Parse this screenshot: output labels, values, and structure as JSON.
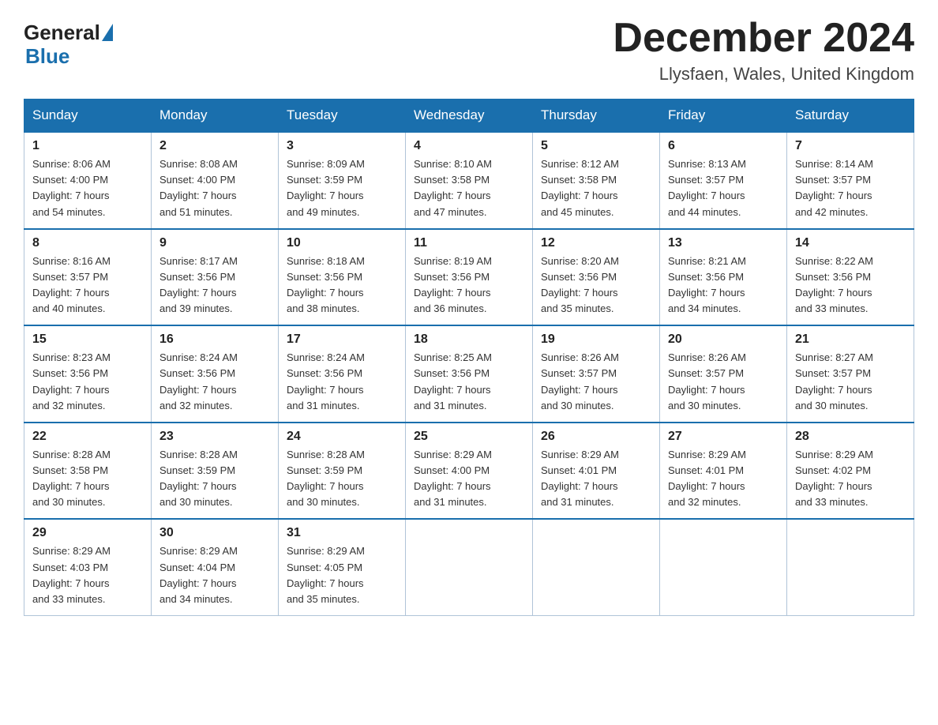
{
  "header": {
    "logo_general": "General",
    "logo_blue": "Blue",
    "month_year": "December 2024",
    "location": "Llysfaen, Wales, United Kingdom"
  },
  "weekdays": [
    "Sunday",
    "Monday",
    "Tuesday",
    "Wednesday",
    "Thursday",
    "Friday",
    "Saturday"
  ],
  "weeks": [
    [
      {
        "day": "1",
        "sunrise": "8:06 AM",
        "sunset": "4:00 PM",
        "daylight": "7 hours and 54 minutes."
      },
      {
        "day": "2",
        "sunrise": "8:08 AM",
        "sunset": "4:00 PM",
        "daylight": "7 hours and 51 minutes."
      },
      {
        "day": "3",
        "sunrise": "8:09 AM",
        "sunset": "3:59 PM",
        "daylight": "7 hours and 49 minutes."
      },
      {
        "day": "4",
        "sunrise": "8:10 AM",
        "sunset": "3:58 PM",
        "daylight": "7 hours and 47 minutes."
      },
      {
        "day": "5",
        "sunrise": "8:12 AM",
        "sunset": "3:58 PM",
        "daylight": "7 hours and 45 minutes."
      },
      {
        "day": "6",
        "sunrise": "8:13 AM",
        "sunset": "3:57 PM",
        "daylight": "7 hours and 44 minutes."
      },
      {
        "day": "7",
        "sunrise": "8:14 AM",
        "sunset": "3:57 PM",
        "daylight": "7 hours and 42 minutes."
      }
    ],
    [
      {
        "day": "8",
        "sunrise": "8:16 AM",
        "sunset": "3:57 PM",
        "daylight": "7 hours and 40 minutes."
      },
      {
        "day": "9",
        "sunrise": "8:17 AM",
        "sunset": "3:56 PM",
        "daylight": "7 hours and 39 minutes."
      },
      {
        "day": "10",
        "sunrise": "8:18 AM",
        "sunset": "3:56 PM",
        "daylight": "7 hours and 38 minutes."
      },
      {
        "day": "11",
        "sunrise": "8:19 AM",
        "sunset": "3:56 PM",
        "daylight": "7 hours and 36 minutes."
      },
      {
        "day": "12",
        "sunrise": "8:20 AM",
        "sunset": "3:56 PM",
        "daylight": "7 hours and 35 minutes."
      },
      {
        "day": "13",
        "sunrise": "8:21 AM",
        "sunset": "3:56 PM",
        "daylight": "7 hours and 34 minutes."
      },
      {
        "day": "14",
        "sunrise": "8:22 AM",
        "sunset": "3:56 PM",
        "daylight": "7 hours and 33 minutes."
      }
    ],
    [
      {
        "day": "15",
        "sunrise": "8:23 AM",
        "sunset": "3:56 PM",
        "daylight": "7 hours and 32 minutes."
      },
      {
        "day": "16",
        "sunrise": "8:24 AM",
        "sunset": "3:56 PM",
        "daylight": "7 hours and 32 minutes."
      },
      {
        "day": "17",
        "sunrise": "8:24 AM",
        "sunset": "3:56 PM",
        "daylight": "7 hours and 31 minutes."
      },
      {
        "day": "18",
        "sunrise": "8:25 AM",
        "sunset": "3:56 PM",
        "daylight": "7 hours and 31 minutes."
      },
      {
        "day": "19",
        "sunrise": "8:26 AM",
        "sunset": "3:57 PM",
        "daylight": "7 hours and 30 minutes."
      },
      {
        "day": "20",
        "sunrise": "8:26 AM",
        "sunset": "3:57 PM",
        "daylight": "7 hours and 30 minutes."
      },
      {
        "day": "21",
        "sunrise": "8:27 AM",
        "sunset": "3:57 PM",
        "daylight": "7 hours and 30 minutes."
      }
    ],
    [
      {
        "day": "22",
        "sunrise": "8:28 AM",
        "sunset": "3:58 PM",
        "daylight": "7 hours and 30 minutes."
      },
      {
        "day": "23",
        "sunrise": "8:28 AM",
        "sunset": "3:59 PM",
        "daylight": "7 hours and 30 minutes."
      },
      {
        "day": "24",
        "sunrise": "8:28 AM",
        "sunset": "3:59 PM",
        "daylight": "7 hours and 30 minutes."
      },
      {
        "day": "25",
        "sunrise": "8:29 AM",
        "sunset": "4:00 PM",
        "daylight": "7 hours and 31 minutes."
      },
      {
        "day": "26",
        "sunrise": "8:29 AM",
        "sunset": "4:01 PM",
        "daylight": "7 hours and 31 minutes."
      },
      {
        "day": "27",
        "sunrise": "8:29 AM",
        "sunset": "4:01 PM",
        "daylight": "7 hours and 32 minutes."
      },
      {
        "day": "28",
        "sunrise": "8:29 AM",
        "sunset": "4:02 PM",
        "daylight": "7 hours and 33 minutes."
      }
    ],
    [
      {
        "day": "29",
        "sunrise": "8:29 AM",
        "sunset": "4:03 PM",
        "daylight": "7 hours and 33 minutes."
      },
      {
        "day": "30",
        "sunrise": "8:29 AM",
        "sunset": "4:04 PM",
        "daylight": "7 hours and 34 minutes."
      },
      {
        "day": "31",
        "sunrise": "8:29 AM",
        "sunset": "4:05 PM",
        "daylight": "7 hours and 35 minutes."
      },
      null,
      null,
      null,
      null
    ]
  ],
  "labels": {
    "sunrise": "Sunrise:",
    "sunset": "Sunset:",
    "daylight": "Daylight:"
  }
}
